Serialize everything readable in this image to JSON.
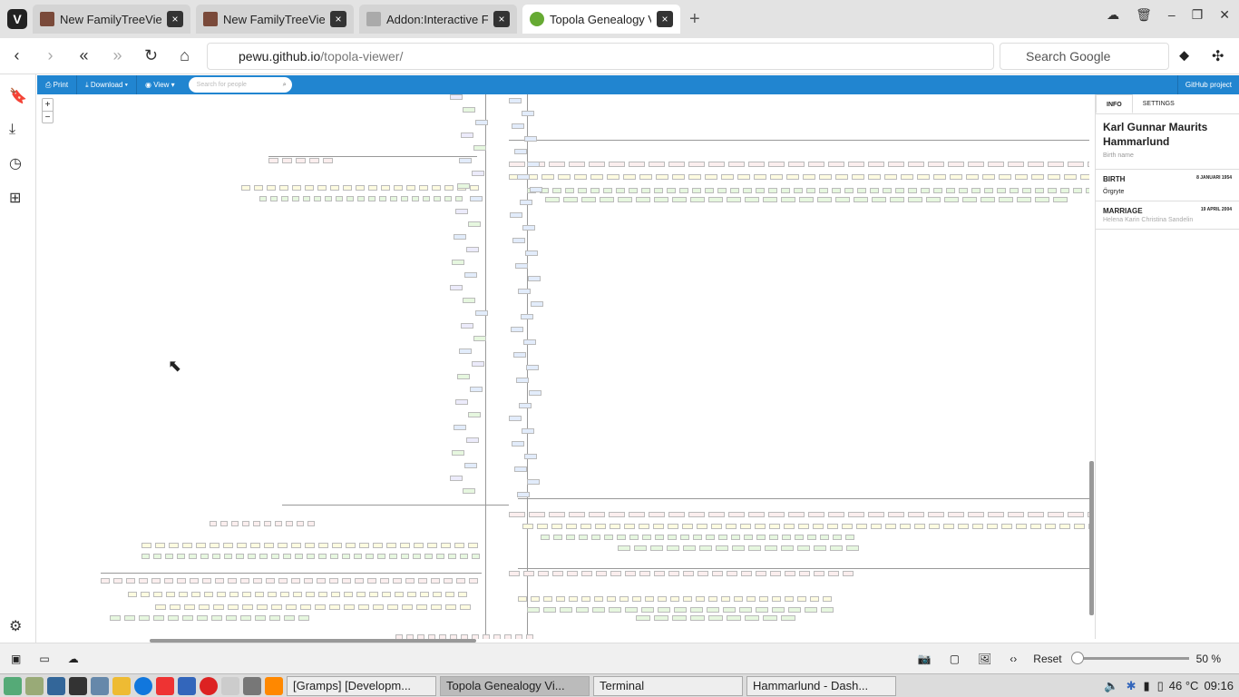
{
  "browser": {
    "tabs": [
      {
        "label": "New FamilyTreeVie..."
      },
      {
        "label": "New FamilyTreeVie..."
      },
      {
        "label": "Addon:Interactive F..."
      },
      {
        "label": "Topola Genealogy Viewer"
      }
    ],
    "url_domain": "pewu.github.io",
    "url_path": "/topola-viewer/",
    "search_placeholder": "Search Google"
  },
  "app": {
    "menu": {
      "print": "Print",
      "download": "Download",
      "view": "View",
      "search_placeholder": "Search for people",
      "github": "GitHub project"
    },
    "zoom_in": "+",
    "zoom_out": "−"
  },
  "info": {
    "tabs": [
      "INFO",
      "SETTINGS"
    ],
    "name": "Karl Gunnar Maurits Hammarlund",
    "name_type": "Birth name",
    "events": [
      {
        "type": "BIRTH",
        "date": "8 JANUARI 1954",
        "detail": "Örgryte"
      },
      {
        "type": "MARRIAGE",
        "date": "19 APRIL 2004",
        "detail": "Helena Karin Christina Sandelin"
      }
    ],
    "colors": {
      "accent": "#2185d0"
    }
  },
  "status": {
    "reset": "Reset",
    "zoom": "50 %",
    "zoom_fraction": 0.0
  },
  "taskbar": {
    "windows": [
      "[Gramps] [Developm...",
      "Topola Genealogy Vi...",
      "Terminal",
      "Hammarlund - Dash..."
    ],
    "temp": "46 °C",
    "time": "09:16"
  }
}
